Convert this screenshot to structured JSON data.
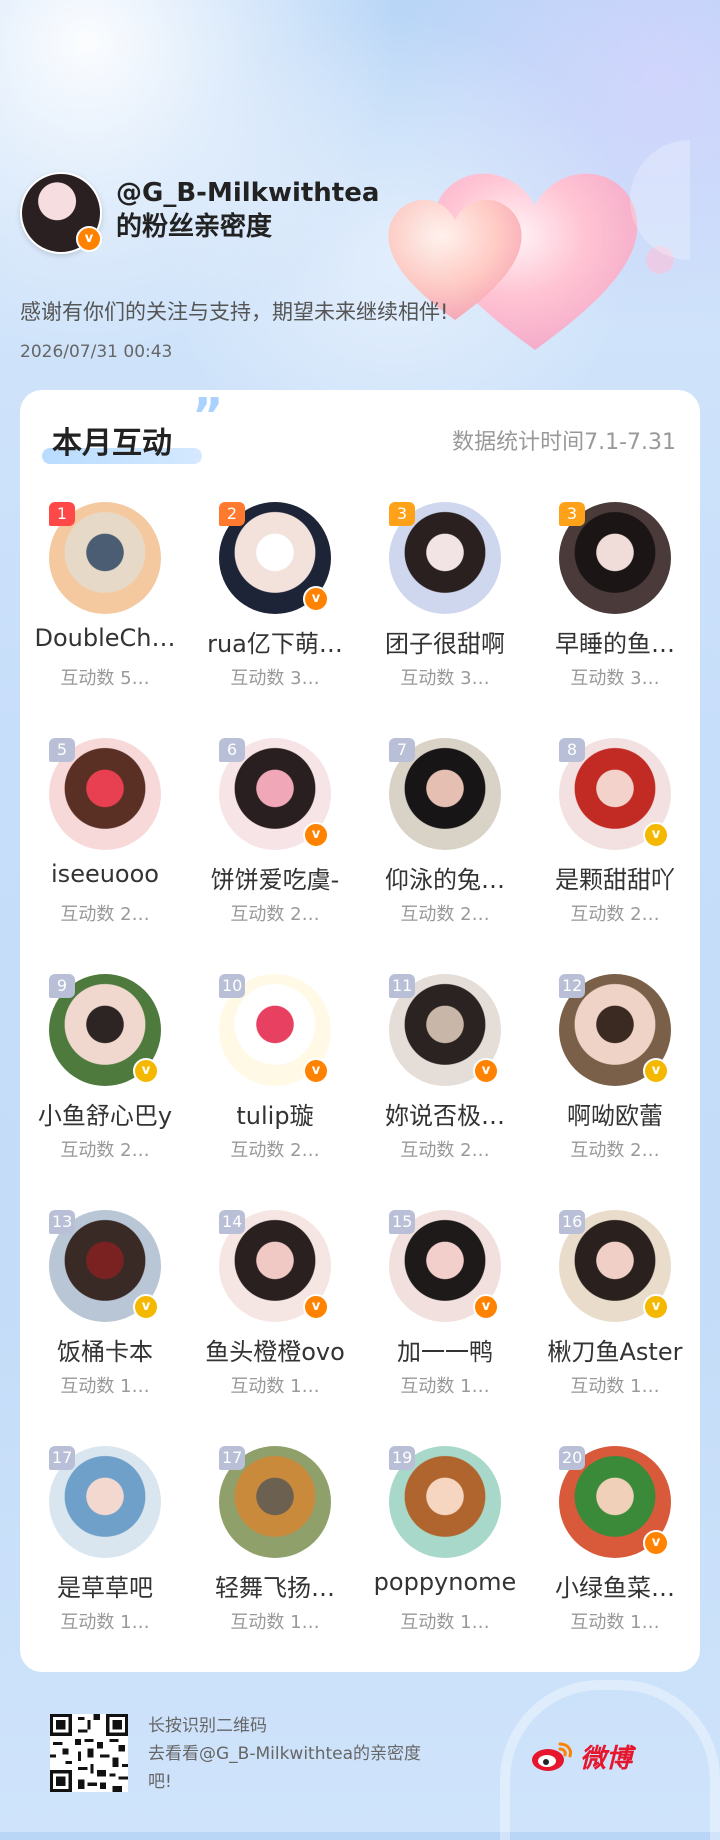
{
  "header": {
    "account_line": "@G_B-Milkwithtea",
    "subtitle_line": "的粉丝亲密度",
    "message": "感谢有你们的关注与支持，期望未来继续相伴!",
    "datetime": "2026/07/31  00:43"
  },
  "card": {
    "title": "本月互动",
    "stats_period": "数据统计时间7.1-7.31"
  },
  "fans": [
    {
      "rank": "1",
      "name": "DoubleCh…",
      "count": "互动数 5…",
      "verified": "",
      "avatar": [
        "#f5c9a0",
        "#e7d9c7",
        "#4b5d73"
      ]
    },
    {
      "rank": "2",
      "name": "rua亿下萌…",
      "count": "互动数 3…",
      "verified": "orange",
      "avatar": [
        "#1d2437",
        "#f3e2dc",
        "#ffffff"
      ]
    },
    {
      "rank": "3",
      "name": "团子很甜啊",
      "count": "互动数 3…",
      "verified": "",
      "avatar": [
        "#cfd7ee",
        "#2a2020",
        "#f2e4e4"
      ]
    },
    {
      "rank": "3",
      "name": "早睡的鱼…",
      "count": "互动数 3…",
      "verified": "",
      "avatar": [
        "#4a3b3a",
        "#1b1516",
        "#f0dcd8"
      ]
    },
    {
      "rank": "5",
      "name": "iseeuooo",
      "count": "互动数 2…",
      "verified": "",
      "avatar": [
        "#f7d9da",
        "#5a3024",
        "#e84050"
      ]
    },
    {
      "rank": "6",
      "name": "饼饼爱吃虞-",
      "count": "互动数 2…",
      "verified": "orange",
      "avatar": [
        "#f7e4e6",
        "#2a1f20",
        "#f0a8b8"
      ]
    },
    {
      "rank": "7",
      "name": "仰泳的兔…",
      "count": "互动数 2…",
      "verified": "",
      "avatar": [
        "#d9d2c6",
        "#171515",
        "#e4bfb2"
      ]
    },
    {
      "rank": "8",
      "name": "是颗甜甜吖",
      "count": "互动数 2…",
      "verified": "gold",
      "avatar": [
        "#f3e1e1",
        "#c22a24",
        "#f4d2cc"
      ]
    },
    {
      "rank": "9",
      "name": "小鱼舒心巴y",
      "count": "互动数 2…",
      "verified": "gold",
      "avatar": [
        "#4e7a3e",
        "#f0d8cf",
        "#2d2524"
      ]
    },
    {
      "rank": "10",
      "name": "tulip璇",
      "count": "互动数 2…",
      "verified": "orange",
      "avatar": [
        "#fff9e6",
        "#ffffff",
        "#e84060"
      ]
    },
    {
      "rank": "11",
      "name": "妳说否极…",
      "count": "互动数 2…",
      "verified": "orange",
      "avatar": [
        "#e4ddd8",
        "#2a2322",
        "#c8b7a8"
      ]
    },
    {
      "rank": "12",
      "name": "啊呦欧蕾",
      "count": "互动数 2…",
      "verified": "gold",
      "avatar": [
        "#7a6048",
        "#efd3c6",
        "#3a2a22"
      ]
    },
    {
      "rank": "13",
      "name": "饭桶卡本",
      "count": "互动数 1…",
      "verified": "gold",
      "avatar": [
        "#b9c6d6",
        "#3a2a26",
        "#7a2222"
      ]
    },
    {
      "rank": "14",
      "name": "鱼头橙橙ovo",
      "count": "互动数 1…",
      "verified": "orange",
      "avatar": [
        "#f5e6e4",
        "#2b2020",
        "#f0c8c4"
      ]
    },
    {
      "rank": "15",
      "name": "加一一鸭",
      "count": "互动数 1…",
      "verified": "orange",
      "avatar": [
        "#f1e0dd",
        "#1f1a1a",
        "#f3cfcc"
      ]
    },
    {
      "rank": "16",
      "name": "楸刀鱼Aster",
      "count": "互动数 1…",
      "verified": "gold",
      "avatar": [
        "#e9dccb",
        "#2a211e",
        "#f0d0c6"
      ]
    },
    {
      "rank": "17",
      "name": "是草草吧",
      "count": "互动数 1…",
      "verified": "",
      "avatar": [
        "#d9e6ef",
        "#6fa0c9",
        "#f2d8cf"
      ]
    },
    {
      "rank": "17",
      "name": "轻舞飞扬…",
      "count": "互动数 1…",
      "verified": "",
      "avatar": [
        "#8fa06a",
        "#c98a3c",
        "#6c6050"
      ]
    },
    {
      "rank": "19",
      "name": "poppynome",
      "count": "互动数 1…",
      "verified": "",
      "avatar": [
        "#a8d8c9",
        "#b0652e",
        "#f6d6c0"
      ]
    },
    {
      "rank": "20",
      "name": "小绿鱼菜…",
      "count": "互动数 1…",
      "verified": "orange",
      "avatar": [
        "#d85a3a",
        "#3a8a3a",
        "#f0d0b8"
      ]
    }
  ],
  "footer": {
    "line1": "长按识别二维码",
    "line2": "去看看@G_B-Milkwithtea的亲密度",
    "line3": "吧!",
    "brand": "微博"
  },
  "colors": {
    "accent_red": "#e6162d",
    "verified_orange": "#ff8200",
    "verified_gold": "#f5b800",
    "rank1": "#ff4848",
    "rank2": "#ff7a2e",
    "rank3": "#ffa21a"
  }
}
